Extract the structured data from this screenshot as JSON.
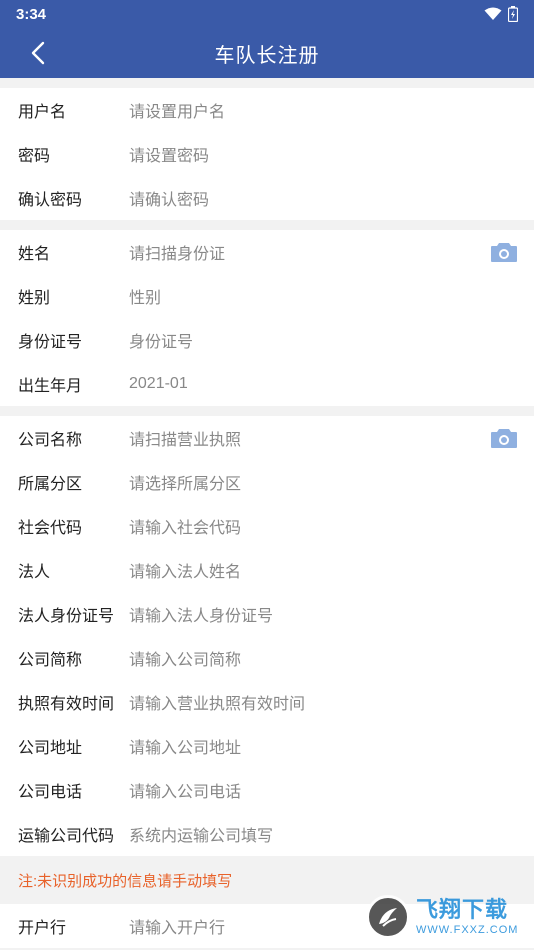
{
  "status_bar": {
    "time": "3:34"
  },
  "header": {
    "title": "车队长注册"
  },
  "groups": [
    [
      {
        "label": "用户名",
        "value": "请设置用户名"
      },
      {
        "label": "密码",
        "value": "请设置密码"
      },
      {
        "label": "确认密码",
        "value": "请确认密码"
      }
    ],
    [
      {
        "label": "姓名",
        "value": "请扫描身份证",
        "camera": true
      },
      {
        "label": "姓别",
        "value": "性别"
      },
      {
        "label": "身份证号",
        "value": "身份证号"
      },
      {
        "label": "出生年月",
        "value": "2021-01"
      }
    ],
    [
      {
        "label": "公司名称",
        "value": "请扫描营业执照",
        "camera": true
      },
      {
        "label": "所属分区",
        "value": "请选择所属分区"
      },
      {
        "label": "社会代码",
        "value": "请输入社会代码"
      },
      {
        "label": "法人",
        "value": "请输入法人姓名"
      },
      {
        "label": "法人身份证号",
        "value": "请输入法人身份证号"
      },
      {
        "label": "公司简称",
        "value": "请输入公司简称"
      },
      {
        "label": "执照有效时间",
        "value": "请输入营业执照有效时间"
      },
      {
        "label": "公司地址",
        "value": "请输入公司地址"
      },
      {
        "label": "公司电话",
        "value": "请输入公司电话"
      },
      {
        "label": "运输公司代码",
        "value": "系统内运输公司填写"
      }
    ]
  ],
  "notice": {
    "text": "注:未识别成功的信息请手动填写",
    "color": "#e8622a"
  },
  "bank_row": {
    "label": "开户行",
    "value": "请输入开户行"
  },
  "watermark": {
    "main": "飞翔下载",
    "sub": "WWW.FXXZ.COM"
  },
  "colors": {
    "primary": "#3a5aa8",
    "camera": "#8fb0e0"
  },
  "icons": {
    "back": "chevron-left-icon",
    "camera": "camera-icon",
    "wifi": "wifi-icon",
    "battery": "battery-icon"
  }
}
